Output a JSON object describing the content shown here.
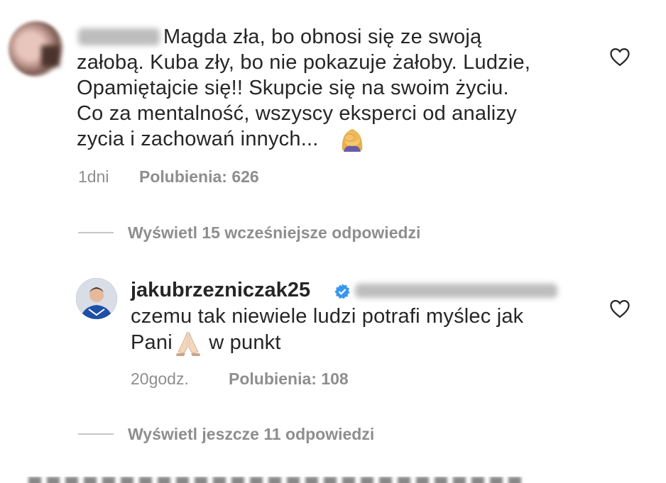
{
  "comment": {
    "text": "Magda zła, bo obnosi się ze swoją\nzałobą. Kuba zły, bo nie pokazuje żałoby. Ludzie,\nOpamiętajcie się!! Skupcie się na swoim życiu.\nCo za mentalność, wszyscy eksperci od analizy\nzycia i zachowań innych...",
    "time": "1dni",
    "likes": "Polubienia: 626"
  },
  "view_earlier": "Wyświetl 15 wcześniejsze odpowiedzi",
  "reply": {
    "username": "jakubrzezniczak25",
    "text_line1": "czemu tak niewiele ludzi potrafi myślec jak",
    "text_pani": "Pani",
    "text_tail": " w punkt",
    "time": "20godz.",
    "likes": "Polubienia: 108"
  },
  "view_more": "Wyświetl jeszcze 11 odpowiedzi",
  "icons": {
    "like": "heart-outline-icon",
    "verified": "verified-badge-icon",
    "facepalm": "woman-facepalming-emoji",
    "pray": "folded-hands-emoji"
  },
  "colors": {
    "text": "#262626",
    "muted": "#8e8e8e",
    "verified": "#3897f0"
  }
}
